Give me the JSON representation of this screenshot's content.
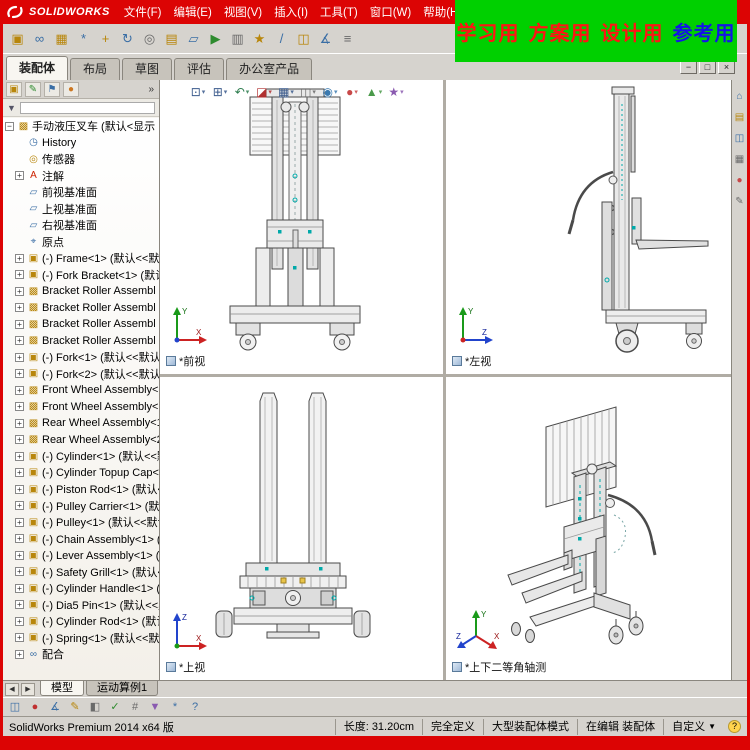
{
  "colors": {
    "frame_red": "#dc0404",
    "banner_green": "#00d000",
    "chrome_gray": "#d6d3ce",
    "viewport_white": "#ffffff"
  },
  "titlebar": {
    "logo": "SOLIDWORKS",
    "menus": [
      "文件(F)",
      "编辑(E)",
      "视图(V)",
      "插入(I)",
      "工具(T)",
      "窗口(W)",
      "帮助(H)"
    ],
    "quick_icons": [
      {
        "name": "search-icon",
        "glyph": "⊙"
      },
      {
        "name": "new-document-icon",
        "glyph": "▯"
      },
      {
        "name": "open-document-icon",
        "glyph": "▱"
      },
      {
        "name": "save-document-icon",
        "glyph": "▣"
      }
    ]
  },
  "banner": {
    "items": [
      {
        "text": "学习用",
        "color": "#ff1414"
      },
      {
        "text": "方案用",
        "color": "#ff1414"
      },
      {
        "text": "设计用",
        "color": "#ff1414"
      },
      {
        "text": "参考用",
        "color": "#1414e6"
      }
    ]
  },
  "assembly_toolbar": {
    "icons": [
      {
        "name": "insert-component-icon",
        "glyph": "▣",
        "color": "#b8860b"
      },
      {
        "name": "mate-icon",
        "glyph": "∞",
        "color": "#3a6ea5"
      },
      {
        "name": "linear-pattern-icon",
        "glyph": "▦",
        "color": "#b8860b"
      },
      {
        "name": "smart-fasteners-icon",
        "glyph": "*",
        "color": "#3a6ea5"
      },
      {
        "name": "move-component-icon",
        "glyph": "+",
        "color": "#b8860b"
      },
      {
        "name": "rotate-component-icon",
        "glyph": "↻",
        "color": "#3a6ea5"
      },
      {
        "name": "show-hidden-components-icon",
        "glyph": "◎",
        "color": "#6a6a6a"
      },
      {
        "name": "assembly-features-icon",
        "glyph": "▤",
        "color": "#b8860b"
      },
      {
        "name": "reference-geometry-icon",
        "glyph": "▱",
        "color": "#3a6ea5"
      },
      {
        "name": "new-motion-study-icon",
        "glyph": "▶",
        "color": "#2e8b2e"
      },
      {
        "name": "bill-of-materials-icon",
        "glyph": "▥",
        "color": "#6a6a6a"
      },
      {
        "name": "exploded-view-icon",
        "glyph": "★",
        "color": "#b8860b"
      },
      {
        "name": "explode-line-sketch-icon",
        "glyph": "/",
        "color": "#3a6ea5"
      },
      {
        "name": "interference-detection-icon",
        "glyph": "◫",
        "color": "#b8860b"
      },
      {
        "name": "measure-icon",
        "glyph": "∡",
        "color": "#3a6ea5"
      },
      {
        "name": "mass-properties-icon",
        "glyph": "≡",
        "color": "#6a6a6a"
      }
    ]
  },
  "command_tabs": {
    "tabs": [
      {
        "label": "装配体",
        "active": true
      },
      {
        "label": "布局",
        "active": false
      },
      {
        "label": "草图",
        "active": false
      },
      {
        "label": "评估",
        "active": false
      },
      {
        "label": "办公室产品",
        "active": false
      }
    ],
    "window_buttons": [
      {
        "name": "minimize-button",
        "glyph": "−"
      },
      {
        "name": "restore-button",
        "glyph": "□"
      },
      {
        "name": "close-button",
        "glyph": "×"
      }
    ]
  },
  "left_panel": {
    "pane_tabs": [
      {
        "name": "featuremanager-tab-icon",
        "glyph": "▣",
        "color": "#b8860b"
      },
      {
        "name": "propertymanager-tab-icon",
        "glyph": "✎",
        "color": "#2e8b2e"
      },
      {
        "name": "configurationmanager-tab-icon",
        "glyph": "⚑",
        "color": "#3a6ea5"
      },
      {
        "name": "displaymanager-tab-icon",
        "glyph": "●",
        "color": "#cc7722"
      }
    ],
    "chevron": "»",
    "filter": {
      "glyph": "▼"
    },
    "tree": {
      "root": {
        "exp": "−",
        "glyph": "▩",
        "label": "手动液压叉车 (默认<显示"
      },
      "items": [
        {
          "exp": "",
          "glyph": "◷",
          "color": "#3a6ea5",
          "label": "History"
        },
        {
          "exp": "",
          "glyph": "◎",
          "color": "#b8860b",
          "label": "传感器"
        },
        {
          "exp": "+",
          "glyph": "A",
          "color": "#cc2200",
          "label": "注解"
        },
        {
          "exp": "",
          "glyph": "▱",
          "color": "#3a6ea5",
          "label": "前视基准面"
        },
        {
          "exp": "",
          "glyph": "▱",
          "color": "#3a6ea5",
          "label": "上视基准面"
        },
        {
          "exp": "",
          "glyph": "▱",
          "color": "#3a6ea5",
          "label": "右视基准面"
        },
        {
          "exp": "",
          "glyph": "⌖",
          "color": "#3a6ea5",
          "label": "原点"
        },
        {
          "exp": "+",
          "glyph": "▣",
          "color": "#b8860b",
          "label": "(-) Frame<1> (默认<<默认"
        },
        {
          "exp": "+",
          "glyph": "▣",
          "color": "#b8860b",
          "label": "(-) Fork Bracket<1> (默认<"
        },
        {
          "exp": "+",
          "glyph": "▩",
          "color": "#b8860b",
          "label": "Bracket Roller Assembl"
        },
        {
          "exp": "+",
          "glyph": "▩",
          "color": "#b8860b",
          "label": "Bracket Roller Assembl"
        },
        {
          "exp": "+",
          "glyph": "▩",
          "color": "#b8860b",
          "label": "Bracket Roller Assembl"
        },
        {
          "exp": "+",
          "glyph": "▩",
          "color": "#b8860b",
          "label": "Bracket Roller Assembl"
        },
        {
          "exp": "+",
          "glyph": "▣",
          "color": "#b8860b",
          "label": "(-) Fork<1> (默认<<默认>_"
        },
        {
          "exp": "+",
          "glyph": "▣",
          "color": "#b8860b",
          "label": "(-) Fork<2> (默认<<默认>"
        },
        {
          "exp": "+",
          "glyph": "▩",
          "color": "#b8860b",
          "label": "Front Wheel Assembly<1"
        },
        {
          "exp": "+",
          "glyph": "▩",
          "color": "#b8860b",
          "label": "Front Wheel Assembly<2"
        },
        {
          "exp": "+",
          "glyph": "▩",
          "color": "#b8860b",
          "label": "Rear Wheel Assembly<1>"
        },
        {
          "exp": "+",
          "glyph": "▩",
          "color": "#b8860b",
          "label": "Rear Wheel Assembly<2"
        },
        {
          "exp": "+",
          "glyph": "▣",
          "color": "#b8860b",
          "label": "(-) Cylinder<1> (默认<<默"
        },
        {
          "exp": "+",
          "glyph": "▣",
          "color": "#b8860b",
          "label": "(-) Cylinder Topup Cap<1>"
        },
        {
          "exp": "+",
          "glyph": "▣",
          "color": "#b8860b",
          "label": "(-) Piston Rod<1> (默认<<"
        },
        {
          "exp": "+",
          "glyph": "▣",
          "color": "#b8860b",
          "label": "(-) Pulley Carrier<1> (默认"
        },
        {
          "exp": "+",
          "glyph": "▣",
          "color": "#b8860b",
          "label": "(-) Pulley<1> (默认<<默认"
        },
        {
          "exp": "+",
          "glyph": "▣",
          "color": "#b8860b",
          "label": "(-) Chain Assembly<1> (默"
        },
        {
          "exp": "+",
          "glyph": "▣",
          "color": "#b8860b",
          "label": "(-) Lever Assembly<1> (默"
        },
        {
          "exp": "+",
          "glyph": "▣",
          "color": "#b8860b",
          "label": "(-) Safety Grill<1> (默认<<"
        },
        {
          "exp": "+",
          "glyph": "▣",
          "color": "#b8860b",
          "label": "(-) Cylinder Handle<1> (默"
        },
        {
          "exp": "+",
          "glyph": "▣",
          "color": "#b8860b",
          "label": "(-) Dia5 Pin<1> (默认<<默"
        },
        {
          "exp": "+",
          "glyph": "▣",
          "color": "#b8860b",
          "label": "(-) Cylinder Rod<1> (默认"
        },
        {
          "exp": "+",
          "glyph": "▣",
          "color": "#b8860b",
          "label": "(-) Spring<1> (默认<<默认"
        },
        {
          "exp": "+",
          "glyph": "∞",
          "color": "#3a6ea5",
          "label": "配合"
        }
      ]
    }
  },
  "heads_up_toolbar": {
    "icons": [
      {
        "name": "zoom-fit-icon",
        "glyph": "⊡",
        "color": "#3a5a8c"
      },
      {
        "name": "zoom-area-icon",
        "glyph": "⊞",
        "color": "#3a5a8c"
      },
      {
        "name": "previous-view-icon",
        "glyph": "↶",
        "color": "#2e7d4f"
      },
      {
        "name": "section-view-icon",
        "glyph": "◪",
        "color": "#b03030"
      },
      {
        "name": "view-orientation-icon",
        "glyph": "▦",
        "color": "#3a5a8c"
      },
      {
        "name": "display-style-icon",
        "glyph": "◫",
        "color": "#6a6a6a"
      },
      {
        "name": "hide-show-items-icon",
        "glyph": "◉",
        "color": "#3a7ab0"
      },
      {
        "name": "edit-appearance-icon",
        "glyph": "●",
        "color": "#c84848"
      },
      {
        "name": "apply-scene-icon",
        "glyph": "▲",
        "color": "#4a9a4a"
      },
      {
        "name": "view-settings-icon",
        "glyph": "★",
        "color": "#8a5ab0"
      }
    ]
  },
  "viewports": [
    {
      "label": "*前视"
    },
    {
      "label": "*左视"
    },
    {
      "label": "*上视"
    },
    {
      "label": "*上下二等角轴测"
    }
  ],
  "task_pane": {
    "icons": [
      {
        "name": "solidworks-resources-icon",
        "glyph": "⌂",
        "color": "#3a6ea5"
      },
      {
        "name": "design-library-icon",
        "glyph": "▤",
        "color": "#b8860b"
      },
      {
        "name": "file-explorer-icon",
        "glyph": "◫",
        "color": "#3a6ea5"
      },
      {
        "name": "view-palette-icon",
        "glyph": "▦",
        "color": "#6a6a6a"
      },
      {
        "name": "appearances-scenes-icon",
        "glyph": "●",
        "color": "#c84848"
      },
      {
        "name": "custom-properties-icon",
        "glyph": "✎",
        "color": "#6a6a6a"
      }
    ]
  },
  "motion_bar": {
    "nav": [
      {
        "name": "scroll-left-icon",
        "glyph": "◀"
      },
      {
        "name": "scroll-right-icon",
        "glyph": "▶"
      }
    ],
    "tabs": [
      {
        "label": "模型",
        "active": true
      },
      {
        "label": "运动算例1",
        "active": false
      }
    ]
  },
  "bottom_toolbar": {
    "icons": [
      {
        "name": "screen-capture-icon",
        "glyph": "◫",
        "color": "#3a6ea5"
      },
      {
        "name": "record-video-icon",
        "glyph": "●",
        "color": "#c03030"
      },
      {
        "name": "measure-tool-icon",
        "glyph": "∡",
        "color": "#3a6ea5"
      },
      {
        "name": "markup-icon",
        "glyph": "✎",
        "color": "#b8860b"
      },
      {
        "name": "compare-icon",
        "glyph": "◧",
        "color": "#6a6a6a"
      },
      {
        "name": "check-icon",
        "glyph": "✓",
        "color": "#2e8b2e"
      },
      {
        "name": "grid-snap-icon",
        "glyph": "#",
        "color": "#6a6a6a"
      },
      {
        "name": "filter-icon",
        "glyph": "▼",
        "color": "#8a5ab0"
      },
      {
        "name": "options-icon",
        "glyph": "*",
        "color": "#3a6ea5"
      },
      {
        "name": "help-icon",
        "glyph": "?",
        "color": "#3a6ea5"
      }
    ]
  },
  "statusbar": {
    "app": "SolidWorks Premium 2014 x64 版",
    "cells": [
      "长度:  31.20cm",
      "完全定义",
      "大型装配体模式",
      "在编辑 装配体"
    ],
    "custom": "自定义",
    "dropdown_glyph": "▼",
    "help_glyph": "?"
  }
}
